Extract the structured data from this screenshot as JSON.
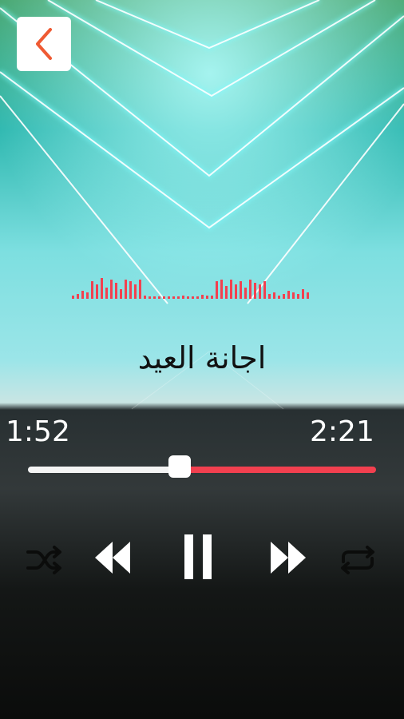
{
  "track": {
    "title": "اجانة العيد",
    "elapsed": "1:52",
    "duration": "2:21",
    "progress": 0.44
  },
  "colors": {
    "accent": "#f2404f",
    "neon": "#8ff8ff",
    "back_icon": "#ef5a33"
  },
  "controls": {
    "back_icon": "chevron-left-icon",
    "shuffle_icon": "shuffle-icon",
    "rewind_icon": "rewind-icon",
    "pause_icon": "pause-icon",
    "forward_icon": "fast-forward-icon",
    "repeat_icon": "repeat-icon"
  }
}
